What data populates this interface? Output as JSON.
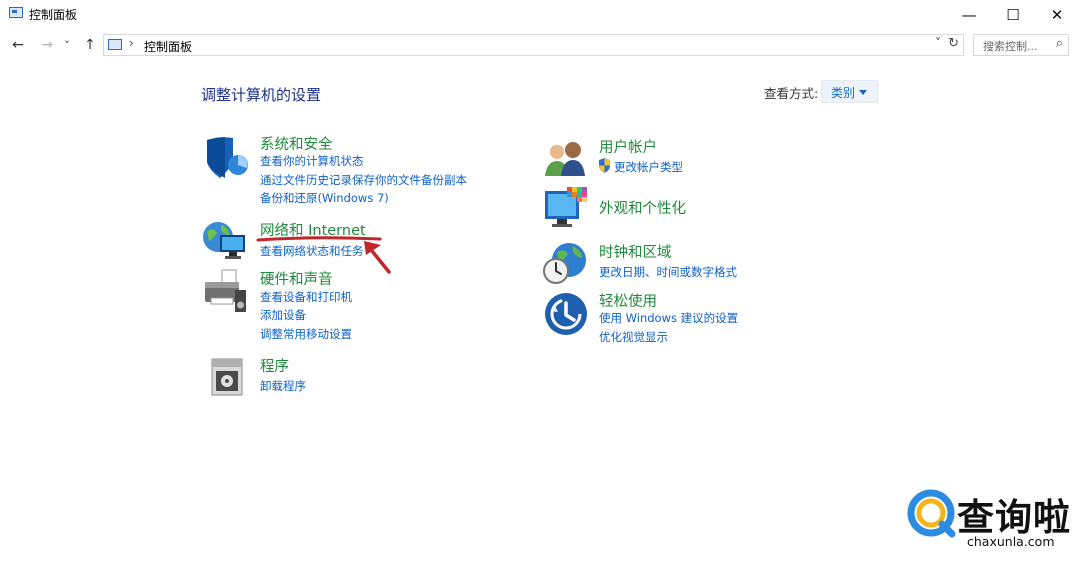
{
  "window": {
    "title": "控制面板"
  },
  "window_controls": {
    "minimize": "—",
    "maximize": "☐",
    "close": "✕"
  },
  "nav": {
    "back": "←",
    "forward": "→",
    "recent": "˅",
    "up": "↑"
  },
  "address": {
    "separator": "›",
    "path": "控制面板",
    "dropdown": "˅",
    "refresh": "↻"
  },
  "search": {
    "placeholder": "搜索控制...",
    "icon": "⌕"
  },
  "main": {
    "title": "调整计算机的设置",
    "view_by_label": "查看方式:",
    "view_by_value": "类别"
  },
  "categories": {
    "system": {
      "title": "系统和安全",
      "links": [
        "查看你的计算机状态",
        "通过文件历史记录保存你的文件备份副本",
        "备份和还原(Windows 7)"
      ]
    },
    "network": {
      "title": "网络和 Internet",
      "links": [
        "查看网络状态和任务"
      ]
    },
    "hardware": {
      "title": "硬件和声音",
      "links": [
        "查看设备和打印机",
        "添加设备",
        "调整常用移动设置"
      ]
    },
    "programs": {
      "title": "程序",
      "links": [
        "卸载程序"
      ]
    },
    "accounts": {
      "title": "用户帐户",
      "links": [
        "更改帐户类型"
      ]
    },
    "appearance": {
      "title": "外观和个性化",
      "links": []
    },
    "clock": {
      "title": "时钟和区域",
      "links": [
        "更改日期、时间或数字格式"
      ]
    },
    "ease": {
      "title": "轻松使用",
      "links": [
        "使用 Windows 建议的设置",
        "优化视觉显示"
      ]
    }
  },
  "watermark": {
    "text": "查询啦",
    "domain": "chaxunla.com"
  },
  "colors": {
    "category_title": "#1f8a3b",
    "link": "#0e62c9",
    "heading": "#1e3287",
    "annotation": "#c0262a"
  }
}
